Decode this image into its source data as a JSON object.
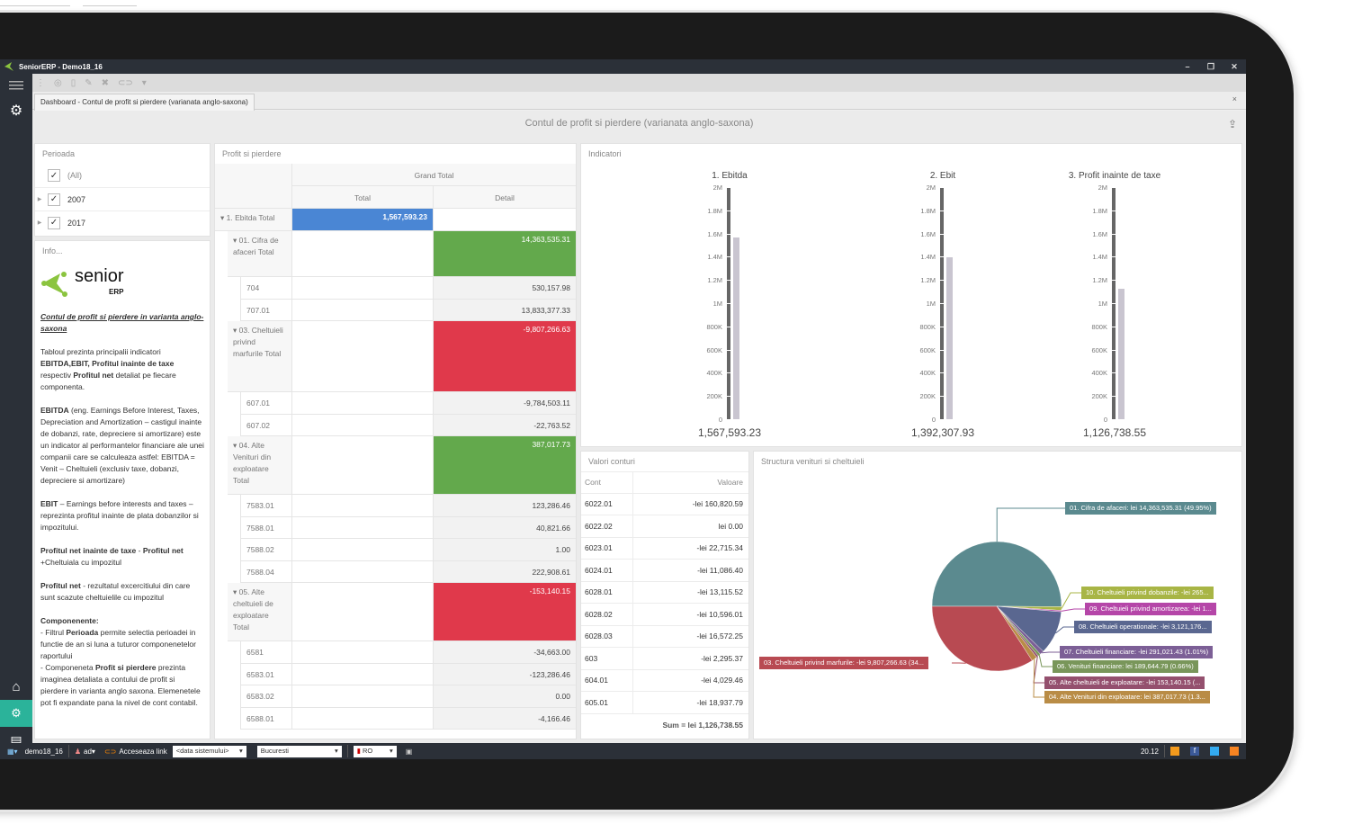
{
  "window": {
    "title": "SeniorERP - Demo18_16",
    "controls": [
      "minimize",
      "restore",
      "close"
    ]
  },
  "toolbar": {
    "icons": [
      "refresh-icon",
      "new-document-icon",
      "edit-icon",
      "delete-icon",
      "link-icon",
      "dropdown-icon"
    ]
  },
  "tab": {
    "label": "Dashboard - Contul de profit si pierdere (varianata anglo-saxona)",
    "close": "×"
  },
  "dashboard": {
    "title": "Contul de profit si pierdere (varianata anglo-saxona)"
  },
  "period": {
    "title": "Perioada",
    "items": [
      {
        "label": "(All)",
        "checked": true
      },
      {
        "label": "2007",
        "checked": true
      },
      {
        "label": "2017",
        "checked": true
      }
    ]
  },
  "info": {
    "title": "Info...",
    "brand": "senior",
    "brand_sub": "ERP",
    "heading": "Contul de profit si pierdere in varianta anglo-saxona",
    "p1_a": "Tabloul prezinta principalii indicatori ",
    "p1_b": "EBITDA,EBIT, Profitul inainte de taxe",
    "p1_c": " respectiv ",
    "p1_d": "Profitul net",
    "p1_e": " detaliat pe fiecare componenta.",
    "p2_a": "EBITDA",
    "p2_b": " (eng. Earnings Before Interest, Taxes, Depreciation and Amortization – castigul inainte de dobanzi, rate, depreciere si amortizare) este un indicator al performantelor financiare ale unei companii care se calculeaza astfel: EBITDA = Venit – Cheltuieli (exclusiv taxe, dobanzi, depreciere si amortizare)",
    "p3_a": "EBIT",
    "p3_b": " – Earnings before interests and taxes – reprezinta profitul inainte de plata dobanzilor si impozitului.",
    "p4_a": "Profitul net inainte de taxe",
    "p4_b": " - ",
    "p4_c": "Profitul net",
    "p4_d": " +Cheltuiala cu impozitul",
    "p5_a": "Profitul net",
    "p5_b": " - rezultatul excercitiului din care sunt scazute cheltuielile cu impozitul",
    "p6_a": "Componenente:",
    "p6_b": "- Filtrul ",
    "p6_c": "Perioada",
    "p6_d": " permite selectia perioadei in functie de an si luna a tuturor componenetelor raportului",
    "p6_e": "- Componeneta ",
    "p6_f": "Profit si pierdere",
    "p6_g": "  prezinta imaginea detaliata a contului de profit si pierdere in varianta anglo saxona. Elemenetele pot fi expandate pana la nivel de cont contabil."
  },
  "pivot": {
    "title": "Profit si pierdere",
    "grand_total": "Grand Total",
    "col_total": "Total",
    "col_detail": "Detail",
    "rows": [
      {
        "label": "▾ 1. Ebitda Total",
        "level": 0,
        "total": "1,567,593.23",
        "detail": "",
        "style": "blue"
      },
      {
        "label": "▾ 01. Cifra de afaceri Total",
        "level": 1,
        "total": "",
        "detail": "14,363,535.31",
        "style": "green"
      },
      {
        "label": "704",
        "level": 2,
        "total": "",
        "detail": "530,157.98",
        "style": "grey"
      },
      {
        "label": "707.01",
        "level": 2,
        "total": "",
        "detail": "13,833,377.33",
        "style": "grey"
      },
      {
        "label": "▾ 03. Cheltuieli privind marfurile Total",
        "level": 1,
        "total": "",
        "detail": "-9,807,266.63",
        "style": "red"
      },
      {
        "label": "607.01",
        "level": 2,
        "total": "",
        "detail": "-9,784,503.11",
        "style": "grey"
      },
      {
        "label": "607.02",
        "level": 2,
        "total": "",
        "detail": "-22,763.52",
        "style": "grey"
      },
      {
        "label": "▾ 04. Alte Venituri din exploatare Total",
        "level": 1,
        "total": "",
        "detail": "387,017.73",
        "style": "green"
      },
      {
        "label": "7583.01",
        "level": 2,
        "total": "",
        "detail": "123,286.46",
        "style": "grey"
      },
      {
        "label": "7588.01",
        "level": 2,
        "total": "",
        "detail": "40,821.66",
        "style": "grey"
      },
      {
        "label": "7588.02",
        "level": 2,
        "total": "",
        "detail": "1.00",
        "style": "grey"
      },
      {
        "label": "7588.04",
        "level": 2,
        "total": "",
        "detail": "222,908.61",
        "style": "grey"
      },
      {
        "label": "▾ 05. Alte cheltuieli de exploatare Total",
        "level": 1,
        "total": "",
        "detail": "-153,140.15",
        "style": "red"
      },
      {
        "label": "6581",
        "level": 2,
        "total": "",
        "detail": "-34,663.00",
        "style": "grey"
      },
      {
        "label": "6583.01",
        "level": 2,
        "total": "",
        "detail": "-123,286.46",
        "style": "grey"
      },
      {
        "label": "6583.02",
        "level": 2,
        "total": "",
        "detail": "0.00",
        "style": "grey"
      },
      {
        "label": "6588.01",
        "level": 2,
        "total": "",
        "detail": "-4,166.46",
        "style": "grey"
      }
    ]
  },
  "indicators": {
    "title": "Indicatori",
    "ticks": [
      "2M",
      "1.8M",
      "1.6M",
      "1.4M",
      "1.2M",
      "1M",
      "800K",
      "600K",
      "400K",
      "200K",
      "0"
    ],
    "max": 2000000,
    "gauges": [
      {
        "title": "1. Ebitda",
        "value": 1567593.23,
        "display": "1,567,593.23"
      },
      {
        "title": "2. Ebit",
        "value": 1392307.93,
        "display": "1,392,307.93"
      },
      {
        "title": "3. Profit inainte de taxe",
        "value": 1126738.55,
        "display": "1,126,738.55"
      }
    ]
  },
  "accounts": {
    "title": "Valori conturi",
    "col_cont": "Cont",
    "col_valoare": "Valoare",
    "rows": [
      {
        "cont": "6022.01",
        "valoare": "-lei 160,820.59"
      },
      {
        "cont": "6022.02",
        "valoare": "lei 0.00"
      },
      {
        "cont": "6023.01",
        "valoare": "-lei 22,715.34"
      },
      {
        "cont": "6024.01",
        "valoare": "-lei 11,086.40"
      },
      {
        "cont": "6028.01",
        "valoare": "-lei 13,115.52"
      },
      {
        "cont": "6028.02",
        "valoare": "-lei 10,596.01"
      },
      {
        "cont": "6028.03",
        "valoare": "-lei 16,572.25"
      },
      {
        "cont": "603",
        "valoare": "-lei 2,295.37"
      },
      {
        "cont": "604.01",
        "valoare": "-lei 4,029.46"
      },
      {
        "cont": "605.01",
        "valoare": "-lei 18,937.79"
      }
    ],
    "sum": "Sum = lei 1,126,738.55"
  },
  "chart_data": {
    "type": "pie",
    "title": "Structura venituri si cheltuieli",
    "slices": [
      {
        "name": "01. Cifra de afaceri",
        "value": 14363535.31,
        "percent": 49.95,
        "color": "#5b8a8f",
        "label": "01. Cifra de afaceri: lei 14,363,535.31 (49.95%)"
      },
      {
        "name": "10. Cheltuieli privind dobanzile",
        "value": 265000,
        "percent": 0.92,
        "color": "#a8b545",
        "label": "10. Cheltuieli privind dobanzile: -lei 265..."
      },
      {
        "name": "09. Cheltuieli privind amortizarea",
        "value": 100000,
        "percent": 0.35,
        "color": "#b546a8",
        "label": "09. Cheltuieli privind amortizarea: -lei 1..."
      },
      {
        "name": "08. Cheltuieli operationale",
        "value": 3121176,
        "percent": 10.85,
        "color": "#5a6790",
        "label": "08. Cheltuieli operationale: -lei 3,121,176..."
      },
      {
        "name": "07. Cheltuieli financiare",
        "value": 291021.43,
        "percent": 1.01,
        "color": "#7c5f96",
        "label": "07. Cheltuieli financiare: -lei 291,021.43 (1.01%)"
      },
      {
        "name": "06. Venituri financiare",
        "value": 189644.79,
        "percent": 0.66,
        "color": "#79965a",
        "label": "06. Venituri financiare: lei 189,644.79 (0.66%)"
      },
      {
        "name": "05. Alte cheltuieli de exploatare",
        "value": 153140.15,
        "percent": 0.53,
        "color": "#94506e",
        "label": "05. Alte cheltuieli de exploatare: -lei 153,140.15 (..."
      },
      {
        "name": "04. Alte Venituri din exploatare",
        "value": 387017.73,
        "percent": 1.35,
        "color": "#b98c46",
        "label": "04. Alte Venituri din exploatare: lei 387,017.73 (1.3..."
      },
      {
        "name": "03. Cheltuieli privind marfurile",
        "value": 9807266.63,
        "percent": 34.1,
        "color": "#b84a52",
        "label": "03. Cheltuieli privind marfurile: -lei 9,807,266.63 (34..."
      }
    ]
  },
  "statusbar": {
    "db": "demo18_16",
    "user": "ad",
    "link": "Acceseaza link",
    "date_select": "<data sistemului>",
    "city_select": "Bucuresti",
    "lang": "RO",
    "time": "20.12"
  }
}
